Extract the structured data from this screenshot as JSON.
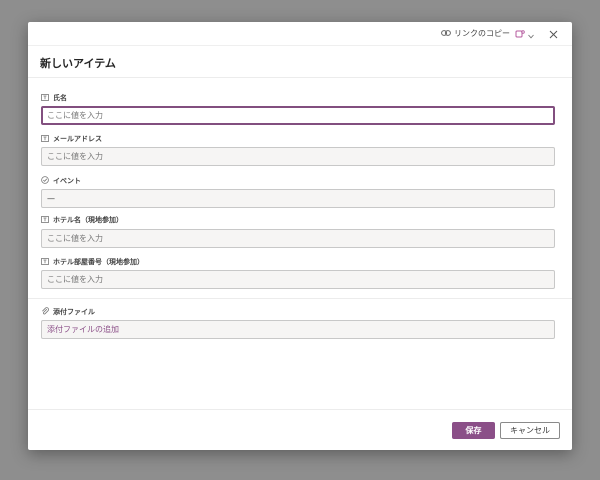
{
  "topbar": {
    "copy_link_label": "リンクのコピー",
    "icons": [
      "link-icon",
      "teams-icon",
      "chevron-down-icon",
      "close-icon"
    ]
  },
  "form": {
    "title": "新しいアイテム",
    "fields": [
      {
        "label": "氏名",
        "placeholder": "ここに値を入力",
        "icon": "text-field-icon"
      },
      {
        "label": "メールアドレス",
        "placeholder": "ここに値を入力",
        "icon": "text-field-icon"
      },
      {
        "label": "イベント",
        "value": "—",
        "icon": "choice-icon"
      },
      {
        "label": "ホテル名（現地参加）",
        "placeholder": "ここに値を入力",
        "icon": "text-field-icon"
      },
      {
        "label": "ホテル部屋番号（現地参加）",
        "placeholder": "ここに値を入力",
        "icon": "text-field-icon"
      }
    ],
    "attachments": {
      "label": "添付ファイル",
      "add_label": "添付ファイルの追加",
      "icon": "paperclip-icon"
    }
  },
  "footer": {
    "save_label": "保存",
    "cancel_label": "キャンセル"
  },
  "colors": {
    "accent": "#8b4f88",
    "overlay": "#8e8e8e"
  }
}
